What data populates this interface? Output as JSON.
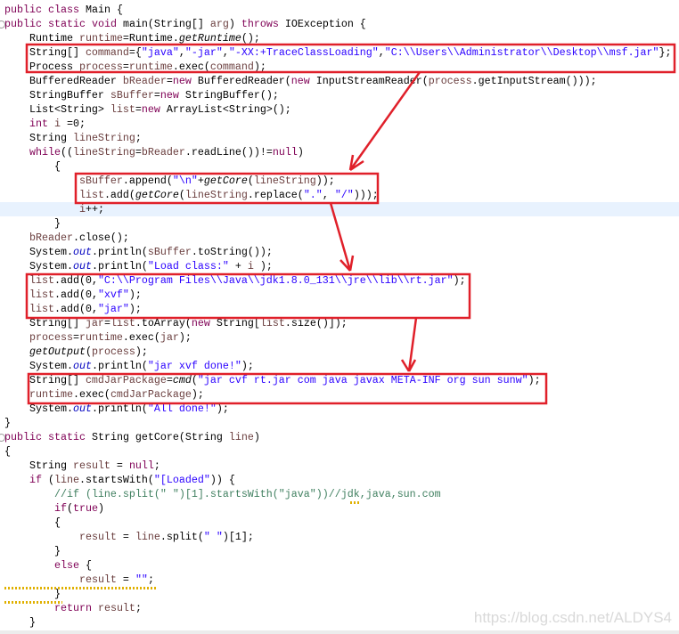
{
  "editor": {
    "highlighted_line": 14,
    "fold_marker_lines": [
      1,
      30
    ],
    "colors": {
      "keyword": "#7f0055",
      "string": "#2a00ff",
      "field": "#0000c0",
      "local": "#6a3e3e",
      "comment": "#3f7f5f",
      "annotation_box": "#e0202a",
      "current_line": "#e8f2fe"
    },
    "annotation_icons": [
      "red-box",
      "red-arrow"
    ]
  },
  "code": {
    "lines": [
      {
        "t": [
          [
            "public",
            "k"
          ],
          [
            " ",
            "p"
          ],
          [
            "class",
            "k"
          ],
          [
            " Main {",
            "p"
          ]
        ]
      },
      {
        "t": [
          [
            "public",
            "k"
          ],
          [
            " ",
            "p"
          ],
          [
            "static",
            "k"
          ],
          [
            " ",
            "p"
          ],
          [
            "void",
            "k"
          ],
          [
            " main(String[] ",
            "p"
          ],
          [
            "arg",
            "v"
          ],
          [
            ") ",
            "p"
          ],
          [
            "throws",
            "k"
          ],
          [
            " IOException {",
            "p"
          ]
        ]
      },
      {
        "t": [
          [
            "    Runtime ",
            "p"
          ],
          [
            "runtime",
            "v"
          ],
          [
            "=Runtime.",
            "p"
          ],
          [
            "getRuntime",
            "m"
          ],
          [
            "();",
            "p"
          ]
        ]
      },
      {
        "t": [
          [
            "    String[] ",
            "p"
          ],
          [
            "command",
            "v"
          ],
          [
            "={",
            "p"
          ],
          [
            "\"java\"",
            "s"
          ],
          [
            ",",
            "p"
          ],
          [
            "\"-jar\"",
            "s"
          ],
          [
            ",",
            "p"
          ],
          [
            "\"-XX:+TraceClassLoading\"",
            "s"
          ],
          [
            ",",
            "p"
          ],
          [
            "\"C:\\\\Users\\\\Administrator\\\\Desktop\\\\msf.jar\"",
            "s"
          ],
          [
            "};",
            "p"
          ]
        ]
      },
      {
        "t": [
          [
            "    Process ",
            "p"
          ],
          [
            "process",
            "v"
          ],
          [
            "=",
            "p"
          ],
          [
            "runtime",
            "v"
          ],
          [
            ".exec(",
            "p"
          ],
          [
            "command",
            "v"
          ],
          [
            ");",
            "p"
          ]
        ]
      },
      {
        "t": [
          [
            "    BufferedReader ",
            "p"
          ],
          [
            "bReader",
            "v"
          ],
          [
            "=",
            "p"
          ],
          [
            "new",
            "k"
          ],
          [
            " BufferedReader(",
            "p"
          ],
          [
            "new",
            "k"
          ],
          [
            " InputStreamReader(",
            "p"
          ],
          [
            "process",
            "v"
          ],
          [
            ".getInputStream()));",
            "p"
          ]
        ]
      },
      {
        "t": [
          [
            "    StringBuffer ",
            "p"
          ],
          [
            "sBuffer",
            "v"
          ],
          [
            "=",
            "p"
          ],
          [
            "new",
            "k"
          ],
          [
            " StringBuffer();",
            "p"
          ]
        ]
      },
      {
        "t": [
          [
            "    List<String> ",
            "p"
          ],
          [
            "list",
            "v"
          ],
          [
            "=",
            "p"
          ],
          [
            "new",
            "k"
          ],
          [
            " ArrayList<String>();",
            "p"
          ]
        ]
      },
      {
        "t": [
          [
            "    ",
            "p"
          ],
          [
            "int",
            "k"
          ],
          [
            " ",
            "p"
          ],
          [
            "i",
            "v"
          ],
          [
            " =0;",
            "p"
          ]
        ]
      },
      {
        "t": [
          [
            "    String ",
            "p"
          ],
          [
            "lineString",
            "v"
          ],
          [
            ";",
            "p"
          ]
        ]
      },
      {
        "t": [
          [
            "    ",
            "p"
          ],
          [
            "while",
            "k"
          ],
          [
            "((",
            "p"
          ],
          [
            "lineString",
            "v"
          ],
          [
            "=",
            "p"
          ],
          [
            "bReader",
            "v"
          ],
          [
            ".readLine())!=",
            "p"
          ],
          [
            "null",
            "k"
          ],
          [
            ")",
            "p"
          ]
        ]
      },
      {
        "t": [
          [
            "        {",
            "p"
          ]
        ]
      },
      {
        "t": [
          [
            "            ",
            "p"
          ],
          [
            "sBuffer",
            "v"
          ],
          [
            ".append(",
            "p"
          ],
          [
            "\"\\n\"",
            "s"
          ],
          [
            "+",
            "p"
          ],
          [
            "getCore",
            "m"
          ],
          [
            "(",
            "p"
          ],
          [
            "lineString",
            "v"
          ],
          [
            "));",
            "p"
          ]
        ]
      },
      {
        "t": [
          [
            "            ",
            "p"
          ],
          [
            "list",
            "v"
          ],
          [
            ".add(",
            "p"
          ],
          [
            "getCore",
            "m"
          ],
          [
            "(",
            "p"
          ],
          [
            "lineString",
            "v"
          ],
          [
            ".replace(",
            "p"
          ],
          [
            "\".\"",
            "s"
          ],
          [
            ", ",
            "p"
          ],
          [
            "\"/\"",
            "s"
          ],
          [
            ")));",
            "p"
          ]
        ]
      },
      {
        "t": [
          [
            "            ",
            "p"
          ],
          [
            "i",
            "v"
          ],
          [
            "++;",
            "p"
          ]
        ]
      },
      {
        "t": [
          [
            "        }",
            "p"
          ]
        ]
      },
      {
        "t": [
          [
            "    ",
            "p"
          ],
          [
            "bReader",
            "v"
          ],
          [
            ".close();",
            "p"
          ]
        ]
      },
      {
        "t": [
          [
            "    System.",
            "p"
          ],
          [
            "out",
            "f"
          ],
          [
            ".println(",
            "p"
          ],
          [
            "sBuffer",
            "v"
          ],
          [
            ".toString());",
            "p"
          ]
        ]
      },
      {
        "t": [
          [
            "    System.",
            "p"
          ],
          [
            "out",
            "f"
          ],
          [
            ".println(",
            "p"
          ],
          [
            "\"Load class:\"",
            "s"
          ],
          [
            " + ",
            "p"
          ],
          [
            "i",
            "v"
          ],
          [
            " );",
            "p"
          ]
        ]
      },
      {
        "t": [
          [
            "    ",
            "p"
          ],
          [
            "list",
            "v"
          ],
          [
            ".add(0,",
            "p"
          ],
          [
            "\"C:\\\\Program Files\\\\Java\\\\jdk1.8.0_131\\\\jre\\\\lib\\\\rt.jar\"",
            "s"
          ],
          [
            ");",
            "p"
          ]
        ]
      },
      {
        "t": [
          [
            "    ",
            "p"
          ],
          [
            "list",
            "v"
          ],
          [
            ".add(0,",
            "p"
          ],
          [
            "\"xvf\"",
            "s"
          ],
          [
            ");",
            "p"
          ]
        ]
      },
      {
        "t": [
          [
            "    ",
            "p"
          ],
          [
            "list",
            "v"
          ],
          [
            ".add(0,",
            "p"
          ],
          [
            "\"jar\"",
            "s"
          ],
          [
            ");",
            "p"
          ]
        ]
      },
      {
        "t": [
          [
            "    String[] ",
            "p"
          ],
          [
            "jar",
            "v"
          ],
          [
            "=",
            "p"
          ],
          [
            "list",
            "v"
          ],
          [
            ".toArray(",
            "p"
          ],
          [
            "new",
            "k"
          ],
          [
            " String[",
            "p"
          ],
          [
            "list",
            "v"
          ],
          [
            ".size()]);",
            "p"
          ]
        ]
      },
      {
        "t": [
          [
            "    ",
            "p"
          ],
          [
            "process",
            "v"
          ],
          [
            "=",
            "p"
          ],
          [
            "runtime",
            "v"
          ],
          [
            ".exec(",
            "p"
          ],
          [
            "jar",
            "v"
          ],
          [
            ");",
            "p"
          ]
        ]
      },
      {
        "t": [
          [
            "    ",
            "p"
          ],
          [
            "getOutput",
            "m"
          ],
          [
            "(",
            "p"
          ],
          [
            "process",
            "v"
          ],
          [
            ");",
            "p"
          ]
        ]
      },
      {
        "t": [
          [
            "    System.",
            "p"
          ],
          [
            "out",
            "f"
          ],
          [
            ".println(",
            "p"
          ],
          [
            "\"jar xvf done!\"",
            "s"
          ],
          [
            ");",
            "p"
          ]
        ]
      },
      {
        "t": [
          [
            "    String[] ",
            "p"
          ],
          [
            "cmdJarPackage",
            "v"
          ],
          [
            "=",
            "p"
          ],
          [
            "cmd",
            "m"
          ],
          [
            "(",
            "p"
          ],
          [
            "\"jar cvf rt.jar com java javax META-INF org sun sunw\"",
            "s"
          ],
          [
            ");",
            "p"
          ]
        ]
      },
      {
        "t": [
          [
            "    ",
            "p"
          ],
          [
            "runtime",
            "v"
          ],
          [
            ".exec(",
            "p"
          ],
          [
            "cmdJarPackage",
            "v"
          ],
          [
            ");",
            "p"
          ]
        ]
      },
      {
        "t": [
          [
            "    System.",
            "p"
          ],
          [
            "out",
            "f"
          ],
          [
            ".println(",
            "p"
          ],
          [
            "\"All done!\"",
            "s"
          ],
          [
            ");",
            "p"
          ]
        ]
      },
      {
        "t": [
          [
            "}",
            "p"
          ]
        ]
      },
      {
        "t": [
          [
            "public",
            "k"
          ],
          [
            " ",
            "p"
          ],
          [
            "static",
            "k"
          ],
          [
            " String getCore(String ",
            "p"
          ],
          [
            "line",
            "v"
          ],
          [
            ")",
            "p"
          ]
        ]
      },
      {
        "t": [
          [
            "{",
            "p"
          ]
        ]
      },
      {
        "t": [
          [
            "    String ",
            "p"
          ],
          [
            "result",
            "v"
          ],
          [
            " = ",
            "p"
          ],
          [
            "null",
            "k"
          ],
          [
            ";",
            "p"
          ]
        ]
      },
      {
        "t": [
          [
            "    ",
            "p"
          ],
          [
            "if",
            "k"
          ],
          [
            " (",
            "p"
          ],
          [
            "line",
            "v"
          ],
          [
            ".startsWith(",
            "p"
          ],
          [
            "\"[Loaded\"",
            "s"
          ],
          [
            ")) {",
            "p"
          ]
        ]
      },
      {
        "t": [
          [
            "        ",
            "p"
          ],
          [
            "//if (line.split(\" \")[1].startsWith(\"java\"))//jdk,java,sun.com",
            "c"
          ]
        ]
      },
      {
        "t": [
          [
            "        ",
            "p"
          ],
          [
            "if",
            "k"
          ],
          [
            "(",
            "p"
          ],
          [
            "true",
            "k"
          ],
          [
            ")",
            "p"
          ]
        ]
      },
      {
        "t": [
          [
            "        {",
            "p"
          ]
        ]
      },
      {
        "t": [
          [
            "            ",
            "p"
          ],
          [
            "result",
            "v"
          ],
          [
            " = ",
            "p"
          ],
          [
            "line",
            "v"
          ],
          [
            ".split(",
            "p"
          ],
          [
            "\" \"",
            "s"
          ],
          [
            ")[1];",
            "p"
          ]
        ]
      },
      {
        "t": [
          [
            "        }",
            "p"
          ]
        ]
      },
      {
        "t": [
          [
            "        ",
            "p"
          ],
          [
            "else",
            "k"
          ],
          [
            " {",
            "p"
          ]
        ]
      },
      {
        "t": [
          [
            "            ",
            "p"
          ],
          [
            "result",
            "v"
          ],
          [
            " = ",
            "p"
          ],
          [
            "\"\"",
            "s"
          ],
          [
            ";",
            "p"
          ]
        ]
      },
      {
        "t": [
          [
            "        }",
            "p"
          ]
        ]
      },
      {
        "t": [
          [
            "        ",
            "p"
          ],
          [
            "return",
            "k"
          ],
          [
            " ",
            "p"
          ],
          [
            "result",
            "v"
          ],
          [
            ";",
            "p"
          ]
        ]
      },
      {
        "t": [
          [
            "    }",
            "p"
          ]
        ]
      }
    ]
  },
  "watermark": "https://blog.csdn.net/ALDYS4"
}
